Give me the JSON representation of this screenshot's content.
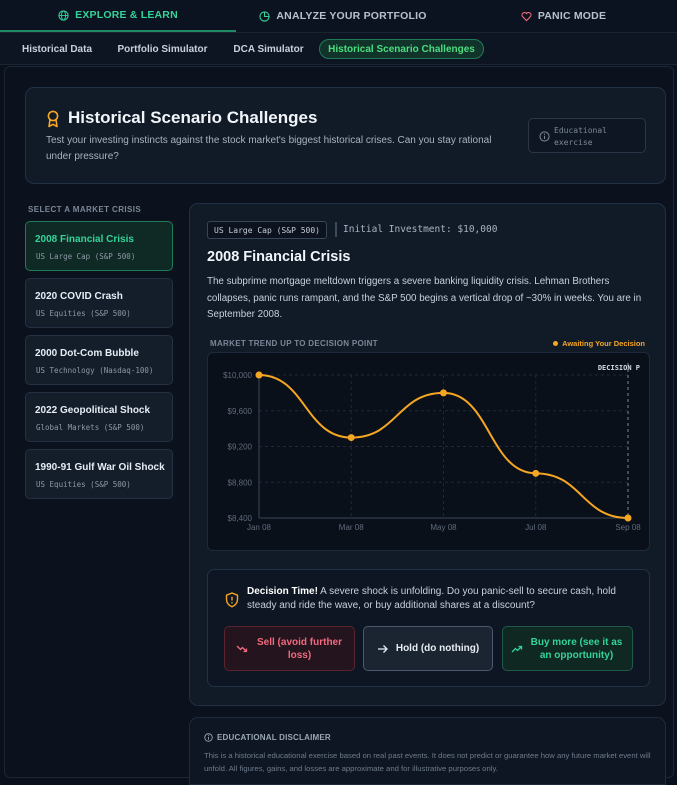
{
  "nav": {
    "tabs": [
      {
        "label": "EXPLORE & LEARN",
        "icon": "globe-icon",
        "active": true
      },
      {
        "label": "ANALYZE YOUR PORTFOLIO",
        "icon": "pie-chart-icon",
        "active": false
      },
      {
        "label": "PANIC MODE",
        "icon": "heart-icon",
        "active": false
      }
    ]
  },
  "subtabs": [
    {
      "label": "Historical Data",
      "active": false
    },
    {
      "label": "Portfolio Simulator",
      "active": false
    },
    {
      "label": "DCA Simulator",
      "active": false
    },
    {
      "label": "Historical Scenario Challenges",
      "active": true
    }
  ],
  "hero": {
    "title": "Historical Scenario Challenges",
    "description": "Test your investing instincts against the stock market's biggest historical crises. Can you stay rational under pressure?",
    "badge_line1": "Educational",
    "badge_line2": "exercise"
  },
  "sidebar": {
    "label": "SELECT A MARKET CRISIS",
    "crises": [
      {
        "name": "2008 Financial Crisis",
        "sub": "US Large Cap (S&P 500)",
        "active": true
      },
      {
        "name": "2020 COVID Crash",
        "sub": "US Equities (S&P 500)",
        "active": false
      },
      {
        "name": "2000 Dot-Com Bubble",
        "sub": "US Technology (Nasdaq-100)",
        "active": false
      },
      {
        "name": "2022 Geopolitical Shock",
        "sub": "Global Markets (S&P 500)",
        "active": false
      },
      {
        "name": "1990-91 Gulf War Oil Shock",
        "sub": "US Equities (S&P 500)",
        "active": false
      }
    ]
  },
  "scenario": {
    "tag": "US Large Cap (S&P 500)",
    "investment": "Initial Investment: $10,000",
    "title": "2008 Financial Crisis",
    "description": "The subprime mortgage meltdown triggers a severe banking liquidity crisis. Lehman Brothers collapses, panic runs rampant, and the S&P 500 begins a vertical drop of ~30% in weeks. You are in September 2008.",
    "trend_label": "MARKET TREND UP TO DECISION POINT",
    "status": "Awaiting Your Decision"
  },
  "chart_data": {
    "type": "line",
    "x": [
      "Jan 08",
      "Mar 08",
      "May 08",
      "Jul 08",
      "Sep 08"
    ],
    "values": [
      10000,
      9300,
      9800,
      8900,
      8400
    ],
    "ylim": [
      8400,
      10000
    ],
    "y_ticks": [
      "$10,000",
      "$9,600",
      "$9,200",
      "$8,800",
      "$8,400"
    ],
    "y_tick_values": [
      10000,
      9600,
      9200,
      8800,
      8400
    ],
    "annotation": "DECISION P",
    "grid": true,
    "line_color": "#f5a623"
  },
  "decision": {
    "lead": "Decision Time!",
    "text": " A severe shock is unfolding. Do you panic-sell to secure cash, hold steady and ride the wave, or buy additional shares at a discount?",
    "sell": "Sell (avoid further loss)",
    "hold": "Hold (do nothing)",
    "buy": "Buy more (see it as an opportunity)"
  },
  "disclaimer": {
    "title": "EDUCATIONAL DISCLAIMER",
    "body": "This is a historical educational exercise based on real past events. It does not predict or guarantee how any future market event will unfold. All figures, gains, and losses are approximate and for illustrative purposes only."
  },
  "colors": {
    "accent": "#34d399",
    "warning": "#f5a623",
    "danger": "#f26a7e",
    "bg": "#0a111c"
  }
}
